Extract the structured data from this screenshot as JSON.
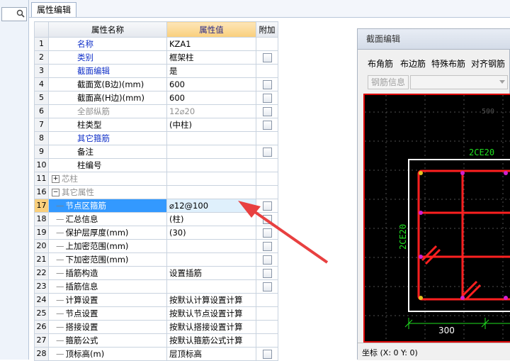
{
  "tab": {
    "label": "属性编辑"
  },
  "grid": {
    "headers": {
      "name": "属性名称",
      "value": "属性值",
      "extra": "附加"
    },
    "rows": [
      {
        "num": "1",
        "name": "名称",
        "value": "KZA1",
        "style": "blue",
        "check": false,
        "indent": 0
      },
      {
        "num": "2",
        "name": "类别",
        "value": "框架柱",
        "style": "blue",
        "check": true,
        "indent": 0
      },
      {
        "num": "3",
        "name": "截面编辑",
        "value": "是",
        "style": "blue",
        "check": false,
        "indent": 0
      },
      {
        "num": "4",
        "name": "截面宽(B边)(mm)",
        "value": "600",
        "style": "",
        "check": true,
        "indent": 0
      },
      {
        "num": "5",
        "name": "截面高(H边)(mm)",
        "value": "600",
        "style": "",
        "check": true,
        "indent": 0
      },
      {
        "num": "6",
        "name": "全部纵筋",
        "value": "12⌀20",
        "style": "gray",
        "check": true,
        "indent": 0,
        "valgray": true
      },
      {
        "num": "7",
        "name": "柱类型",
        "value": "(中柱)",
        "style": "",
        "check": true,
        "indent": 0
      },
      {
        "num": "8",
        "name": "其它箍筋",
        "value": "",
        "style": "blue",
        "check": false,
        "indent": 0
      },
      {
        "num": "9",
        "name": "备注",
        "value": "",
        "style": "",
        "check": true,
        "indent": 0
      },
      {
        "num": "10",
        "name": "柱编号",
        "value": "",
        "style": "",
        "check": false,
        "indent": 0
      },
      {
        "num": "11",
        "name": "芯柱",
        "value": "",
        "style": "gray",
        "check": false,
        "indent": 0,
        "expander": "+"
      },
      {
        "num": "16",
        "name": "其它属性",
        "value": "",
        "style": "gray",
        "check": false,
        "indent": 0,
        "expander": "−"
      },
      {
        "num": "17",
        "name": "节点区箍筋",
        "value": "⌀12@100",
        "style": "",
        "check": true,
        "indent": 1,
        "selected": true
      },
      {
        "num": "18",
        "name": "汇总信息",
        "value": "(柱)",
        "style": "",
        "check": true,
        "indent": 1
      },
      {
        "num": "19",
        "name": "保护层厚度(mm)",
        "value": "(30)",
        "style": "",
        "check": true,
        "indent": 1
      },
      {
        "num": "20",
        "name": "上加密范围(mm)",
        "value": "",
        "style": "",
        "check": true,
        "indent": 1
      },
      {
        "num": "21",
        "name": "下加密范围(mm)",
        "value": "",
        "style": "",
        "check": true,
        "indent": 1
      },
      {
        "num": "22",
        "name": "插筋构造",
        "value": "设置插筋",
        "style": "",
        "check": true,
        "indent": 1
      },
      {
        "num": "23",
        "name": "插筋信息",
        "value": "",
        "style": "",
        "check": true,
        "indent": 1
      },
      {
        "num": "24",
        "name": "计算设置",
        "value": "按默认计算设置计算",
        "style": "",
        "check": false,
        "indent": 1
      },
      {
        "num": "25",
        "name": "节点设置",
        "value": "按默认节点设置计算",
        "style": "",
        "check": false,
        "indent": 1
      },
      {
        "num": "26",
        "name": "搭接设置",
        "value": "按默认搭接设置计算",
        "style": "",
        "check": false,
        "indent": 1
      },
      {
        "num": "27",
        "name": "箍筋公式",
        "value": "按默认箍筋公式计算",
        "style": "",
        "check": false,
        "indent": 1
      },
      {
        "num": "28",
        "name": "顶标高(m)",
        "value": "层顶标高",
        "style": "",
        "check": true,
        "indent": 1
      }
    ]
  },
  "section_panel": {
    "title": "截面编辑",
    "toolbar": [
      "布角筋",
      "布边筋",
      "特殊布筋",
      "对齐钢筋"
    ],
    "rebar_info_label": "钢筋信息",
    "canvas": {
      "top_label": "2CE20",
      "left_label": "2CE20",
      "top_dim": "500",
      "bottom_dim": "300"
    },
    "status": "坐标 (X: 0 Y: 0)"
  },
  "colors": {
    "selection": "#3399ff",
    "header_highlight": "#f9cf7c",
    "rebar": "#ff2020",
    "dimension": "#20e020",
    "arrow": "#e84040"
  }
}
